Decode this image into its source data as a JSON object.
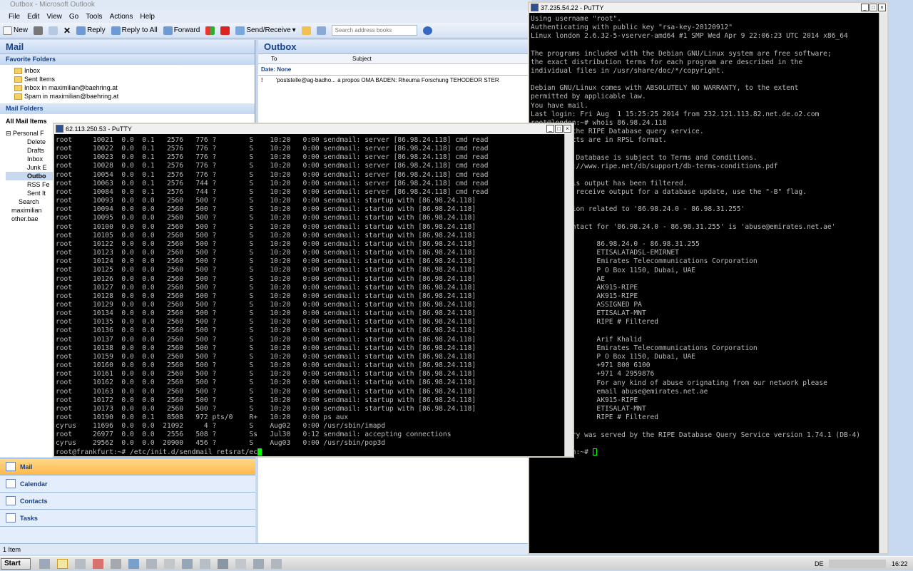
{
  "outlook": {
    "title": "Outbox - Microsoft Outlook",
    "menu": [
      "File",
      "Edit",
      "View",
      "Go",
      "Tools",
      "Actions",
      "Help"
    ],
    "toolbar": {
      "new": "New",
      "reply": "Reply",
      "reply_all": "Reply to All",
      "forward": "Forward",
      "send_receive": "Send/Receive",
      "search_placeholder": "Search address books"
    },
    "nav": {
      "title": "Mail",
      "favorites_head": "Favorite Folders",
      "favorites": [
        "Inbox",
        "Sent Items",
        "Inbox in maximilian@baehring.at",
        "Spam in maximilian@baehring.at"
      ],
      "mail_folders_head": "Mail Folders",
      "all_mail": "All Mail Items",
      "personal": "Personal F",
      "tree": [
        "Delete",
        "Drafts",
        "Inbox",
        "Junk E",
        "Outbo",
        "RSS Fe",
        "Sent It",
        "Search",
        "maximilian",
        "other.bae"
      ]
    },
    "nav_buttons": [
      "Mail",
      "Calendar",
      "Contacts",
      "Tasks"
    ],
    "list": {
      "title": "Outbox",
      "col_to": "To",
      "col_subject": "Subject",
      "group": "Date: None",
      "row_from": "'poststelle@ag-badho...",
      "row_subject": "a propos OMA BADEN: Rheuma Forschung TEHODEOR STER"
    },
    "status": "1 Item"
  },
  "putty_front": {
    "title": "62.113.250.53 - PuTTY",
    "lines": [
      "root     10021  0.0  0.1   2576   776 ?        S    10:20   0:00 sendmail: server [86.98.24.118] cmd read",
      "root     10022  0.0  0.1   2576   776 ?        S    10:20   0:00 sendmail: server [86.98.24.118] cmd read",
      "root     10023  0.0  0.1   2576   776 ?        S    10:20   0:00 sendmail: server [86.98.24.118] cmd read",
      "root     10028  0.0  0.1   2576   776 ?        S    10:20   0:00 sendmail: server [86.98.24.118] cmd read",
      "root     10054  0.0  0.1   2576   776 ?        S    10:20   0:00 sendmail: server [86.98.24.118] cmd read",
      "root     10063  0.0  0.1   2576   744 ?        S    10:20   0:00 sendmail: server [86.98.24.118] cmd read",
      "root     10084  0.0  0.1   2576   744 ?        S    10:20   0:00 sendmail: server [86.98.24.118] cmd read",
      "root     10093  0.0  0.0   2560   500 ?        S    10:20   0:00 sendmail: startup with [86.98.24.118]",
      "root     10094  0.0  0.0   2560   500 ?        S    10:20   0:00 sendmail: startup with [86.98.24.118]",
      "root     10095  0.0  0.0   2560   500 ?        S    10:20   0:00 sendmail: startup with [86.98.24.118]",
      "root     10100  0.0  0.0   2560   500 ?        S    10:20   0:00 sendmail: startup with [86.98.24.118]",
      "root     10105  0.0  0.0   2560   500 ?        S    10:20   0:00 sendmail: startup with [86.98.24.118]",
      "root     10122  0.0  0.0   2560   500 ?        S    10:20   0:00 sendmail: startup with [86.98.24.118]",
      "root     10123  0.0  0.0   2560   500 ?        S    10:20   0:00 sendmail: startup with [86.98.24.118]",
      "root     10124  0.0  0.0   2560   500 ?        S    10:20   0:00 sendmail: startup with [86.98.24.118]",
      "root     10125  0.0  0.0   2560   500 ?        S    10:20   0:00 sendmail: startup with [86.98.24.118]",
      "root     10126  0.0  0.0   2560   500 ?        S    10:20   0:00 sendmail: startup with [86.98.24.118]",
      "root     10127  0.0  0.0   2560   500 ?        S    10:20   0:00 sendmail: startup with [86.98.24.118]",
      "root     10128  0.0  0.0   2560   500 ?        S    10:20   0:00 sendmail: startup with [86.98.24.118]",
      "root     10129  0.0  0.0   2560   500 ?        S    10:20   0:00 sendmail: startup with [86.98.24.118]",
      "root     10134  0.0  0.0   2560   500 ?        S    10:20   0:00 sendmail: startup with [86.98.24.118]",
      "root     10135  0.0  0.0   2560   500 ?        S    10:20   0:00 sendmail: startup with [86.98.24.118]",
      "root     10136  0.0  0.0   2560   500 ?        S    10:20   0:00 sendmail: startup with [86.98.24.118]",
      "root     10137  0.0  0.0   2560   500 ?        S    10:20   0:00 sendmail: startup with [86.98.24.118]",
      "root     10138  0.0  0.0   2560   500 ?        S    10:20   0:00 sendmail: startup with [86.98.24.118]",
      "root     10159  0.0  0.0   2560   500 ?        S    10:20   0:00 sendmail: startup with [86.98.24.118]",
      "root     10160  0.0  0.0   2560   500 ?        S    10:20   0:00 sendmail: startup with [86.98.24.118]",
      "root     10161  0.0  0.0   2560   500 ?        S    10:20   0:00 sendmail: startup with [86.98.24.118]",
      "root     10162  0.0  0.0   2560   500 ?        S    10:20   0:00 sendmail: startup with [86.98.24.118]",
      "root     10163  0.0  0.0   2560   500 ?        S    10:20   0:00 sendmail: startup with [86.98.24.118]",
      "root     10172  0.0  0.0   2560   500 ?        S    10:20   0:00 sendmail: startup with [86.98.24.118]",
      "root     10173  0.0  0.0   2560   500 ?        S    10:20   0:00 sendmail: startup with [86.98.24.118]",
      "root     10190  0.0  0.1   8508   972 pts/0    R+   10:20   0:00 ps aux",
      "cyrus    11696  0.0  0.0  21092     4 ?        S    Aug02   0:00 /usr/sbin/imapd",
      "root     26977  0.0  0.0   2556   508 ?        Ss   Jul30   0:12 sendmail: accepting connections",
      "cyrus    29562  0.0  0.0  20900   456 ?        S    Aug03   0:00 /usr/sbin/pop3d"
    ],
    "prompt": "root@frankfurt:~# /etc/init.d/sendmail retsrat/ec"
  },
  "putty_back": {
    "title": "37.235.54.22 - PuTTY",
    "lines": [
      "Using username \"root\".",
      "Authenticating with public key \"rsa-key-20120912\"",
      "Linux london 2.6.32-5-vserver-amd64 #1 SMP Wed Apr 9 22:06:23 UTC 2014 x86_64",
      "",
      "The programs included with the Debian GNU/Linux system are free software;",
      "the exact distribution terms for each program are described in the",
      "individual files in /usr/share/doc/*/copyright.",
      "",
      "Debian GNU/Linux comes with ABSOLUTELY NO WARRANTY, to the extent",
      "permitted by applicable law.",
      "You have mail.",
      "Last login: Fri Aug  1 15:25:25 2014 from 232.121.113.82.net.de.o2.com",
      "root@london:~# whois 86.98.24.118",
      "% This is the RIPE Database query service.",
      "% The objects are in RPSL format.",
      "%",
      "% The RIPE Database is subject to Terms and Conditions.",
      "% See http://www.ripe.net/db/support/db-terms-conditions.pdf",
      "",
      "% Note: this output has been filtered.",
      "%       To receive output for a database update, use the \"-B\" flag.",
      "",
      "% Information related to '86.98.24.0 - 86.98.31.255'",
      "",
      "% Abuse contact for '86.98.24.0 - 86.98.31.255' is 'abuse@emirates.net.ae'",
      "",
      "inetnum:        86.98.24.0 - 86.98.31.255",
      "netname:        ETISALATADSL-EMIRNET",
      "descr:          Emirates Telecommunications Corporation",
      "descr:          P O Box 1150, Dubai, UAE",
      "country:        AE",
      "admin-c:        AK915-RIPE",
      "tech-c:         AK915-RIPE",
      "status:         ASSIGNED PA",
      "mnt-by:         ETISALAT-MNT",
      "source:         RIPE # Filtered",
      "",
      "person:         Arif Khalid",
      "address:        Emirates Telecommunications Corporation",
      "address:        P O Box 1150, Dubai, UAE",
      "phone:          +971 800 6100",
      "fax-no:         +971 4 2959876",
      "remarks:        For any kind of abuse orignating from our network please",
      "remarks:        email abuse@emirates.net.ae",
      "nic-hdl:        AK915-RIPE",
      "mnt-by:         ETISALAT-MNT",
      "source:         RIPE # Filtered",
      "",
      "% This query was served by the RIPE Database Query Service version 1.74.1 (DB-4)",
      "",
      "root@london:~# "
    ]
  },
  "taskbar": {
    "start": "Start",
    "lang": "DE",
    "clock": "16:22"
  }
}
